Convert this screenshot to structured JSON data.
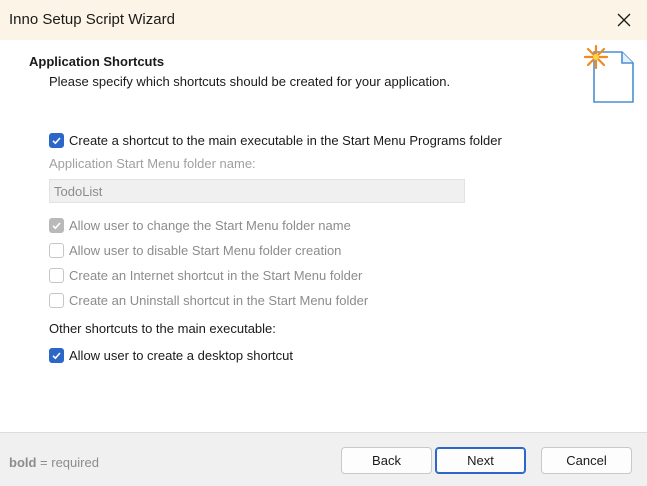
{
  "window": {
    "title": "Inno Setup Script Wizard"
  },
  "header": {
    "title": "Application Shortcuts",
    "subtitle": "Please specify which shortcuts should be created for your application.",
    "icon": "wizard-document-icon"
  },
  "options": {
    "start_menu_shortcut": {
      "label": "Create a shortcut to the main executable in the Start Menu Programs folder",
      "checked": true,
      "enabled": true
    },
    "folder_name_label": "Application Start Menu folder name:",
    "folder_name_value": "TodoList",
    "allow_change_folder": {
      "label": "Allow user to change the Start Menu folder name",
      "checked": true,
      "enabled": false
    },
    "allow_disable_folder": {
      "label": "Allow user to disable Start Menu folder creation",
      "checked": false,
      "enabled": false
    },
    "internet_shortcut": {
      "label": "Create an Internet shortcut in the Start Menu folder",
      "checked": false,
      "enabled": false
    },
    "uninstall_shortcut": {
      "label": "Create an Uninstall shortcut in the Start Menu folder",
      "checked": false,
      "enabled": false
    },
    "other_label": "Other shortcuts to the main executable:",
    "desktop_shortcut": {
      "label": "Allow user to create a desktop shortcut",
      "checked": true,
      "enabled": true
    }
  },
  "footer": {
    "note_bold": "bold",
    "note_rest": " = required",
    "back_label": "Back",
    "next_label": "Next",
    "cancel_label": "Cancel"
  },
  "colors": {
    "titlebar": "#fcf4e6",
    "accent": "#2c66c8",
    "footer": "#f0f0f0"
  }
}
